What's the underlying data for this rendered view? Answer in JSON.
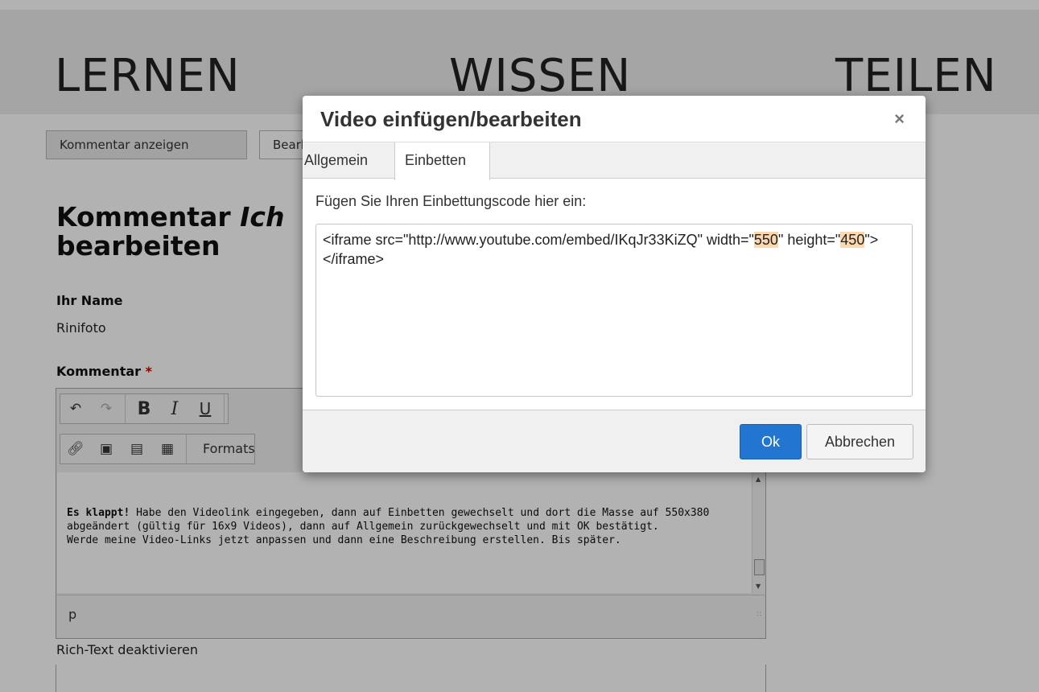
{
  "banner": {
    "left": "LERNEN",
    "center": "WISSEN",
    "right": "TEILEN"
  },
  "page_tabs": {
    "show_comment": "Kommentar anzeigen",
    "edit": "Bearbeiten"
  },
  "heading": {
    "line1_prefix": "Kommentar",
    "line1_italic": "Ich",
    "line2": "bearbeiten"
  },
  "form": {
    "name_label": "Ihr Name",
    "name_value": "Rinifoto",
    "comment_label": "Kommentar",
    "required_mark": "*",
    "format_label": "Formats",
    "body_bold": "Es klappt!",
    "body_text1": " Habe den Videolink eingegeben, dann auf Einbetten gewechselt und dort die Masse auf 550x380 abgeändert (gültig für 16x9 Videos), dann auf Allgemein zurückgewechselt und mit OK bestätigt.",
    "body_text2": "Werde meine Video-Links jetzt anpassen und dann eine Beschreibung erstellen. Bis später.",
    "status_path": "p",
    "disable_rich_text": "Rich-Text deaktivieren"
  },
  "dialog": {
    "title": "Video einfügen/bearbeiten",
    "close": "×",
    "tabs": [
      "Allgemein",
      "Einbetten"
    ],
    "active_tab": "Einbetten",
    "label": "Fügen Sie Ihren Einbettungscode hier ein:",
    "code_part1": "<iframe src=\"http://www.youtube.com/embed/IKqJr33KiZQ\" width=\"",
    "code_width": "550",
    "code_part2": "\" height=\"",
    "code_height": "450",
    "code_part3": "\"></iframe>",
    "ok": "Ok",
    "cancel": "Abbrechen"
  },
  "colors": {
    "ok_button": "#2276d2",
    "highlight": "#fcd8b0",
    "required": "#cc0000"
  }
}
